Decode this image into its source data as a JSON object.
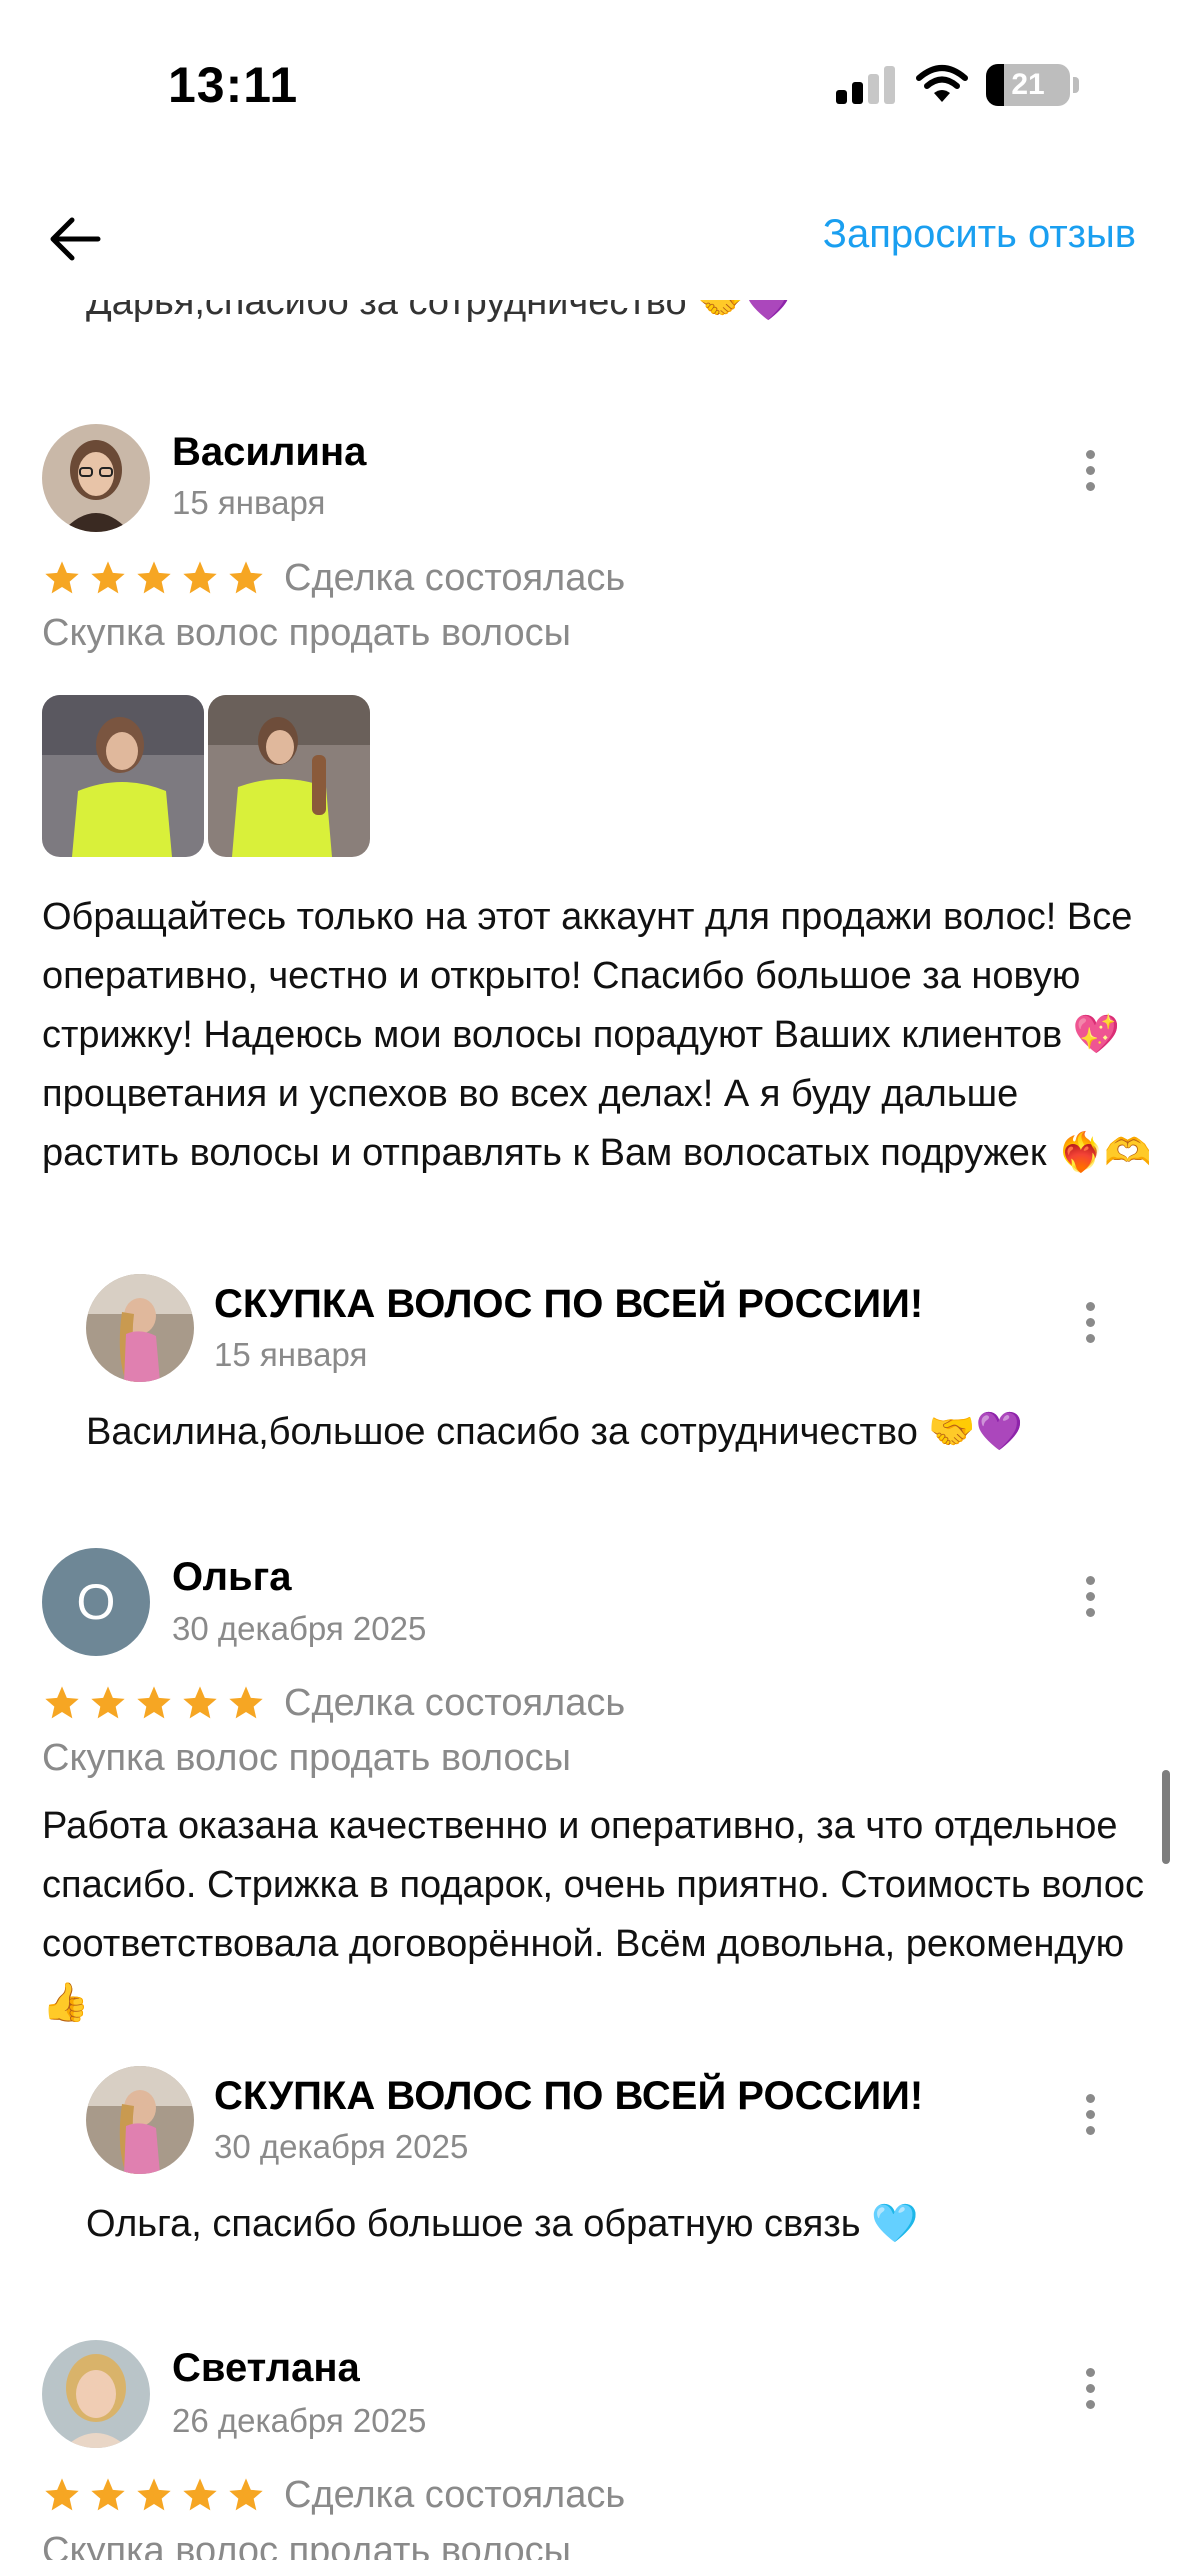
{
  "status_bar": {
    "time": "13:11",
    "battery": "21",
    "battery_level": 0.21
  },
  "nav": {
    "back_icon": "arrow-left-icon",
    "request_review": "Запросить отзыв",
    "accent_color": "#1a9ff0"
  },
  "clipped_previous_reply": "Дарья,спасибо за сотрудничество 🤝💜",
  "reviews": [
    {
      "name": "Василина",
      "date": "15 января",
      "rating": 5,
      "status": "Сделка состоялась",
      "service": "Скупка волос продать волосы",
      "photo_count": 2,
      "text": "Обращайтесь только на этот аккаунт для продажи волос! Все оперативно, честно и открыто! Спасибо большое за новую стрижку! Надеюсь мои волосы порадуют Ваших клиентов 💖 процветания и успехов во всех делах! А я буду дальше растить волосы и отправлять к Вам волосатых подружек ❤️‍🔥🫶",
      "reply": {
        "name": "СКУПКА ВОЛОС ПО ВСЕЙ РОССИИ!",
        "date": "15 января",
        "text": "Василина,большое спасибо за сотрудничество 🤝💜"
      }
    },
    {
      "name": "Ольга",
      "avatar_letter": "О",
      "date": "30 декабря 2025",
      "rating": 5,
      "status": "Сделка состоялась",
      "service": "Скупка волос продать волосы",
      "text": "Работа оказана качественно и оперативно, за что отдельное спасибо. Стрижка в подарок, очень приятно. Стоимость волос соответствовала договорённой. Всём довольна, рекомендую 👍",
      "reply": {
        "name": "СКУПКА ВОЛОС ПО ВСЕЙ РОССИИ!",
        "date": "30 декабря 2025",
        "text": "Ольга, спасибо большое за обратную связь 🩵"
      }
    },
    {
      "name": "Светлана",
      "date": "26 декабря 2025",
      "rating": 5,
      "status": "Сделка состоялась",
      "service": "Скупка волос продать волосы"
    }
  ],
  "colors": {
    "star": "#f6a623",
    "muted": "#8a8a8a"
  }
}
